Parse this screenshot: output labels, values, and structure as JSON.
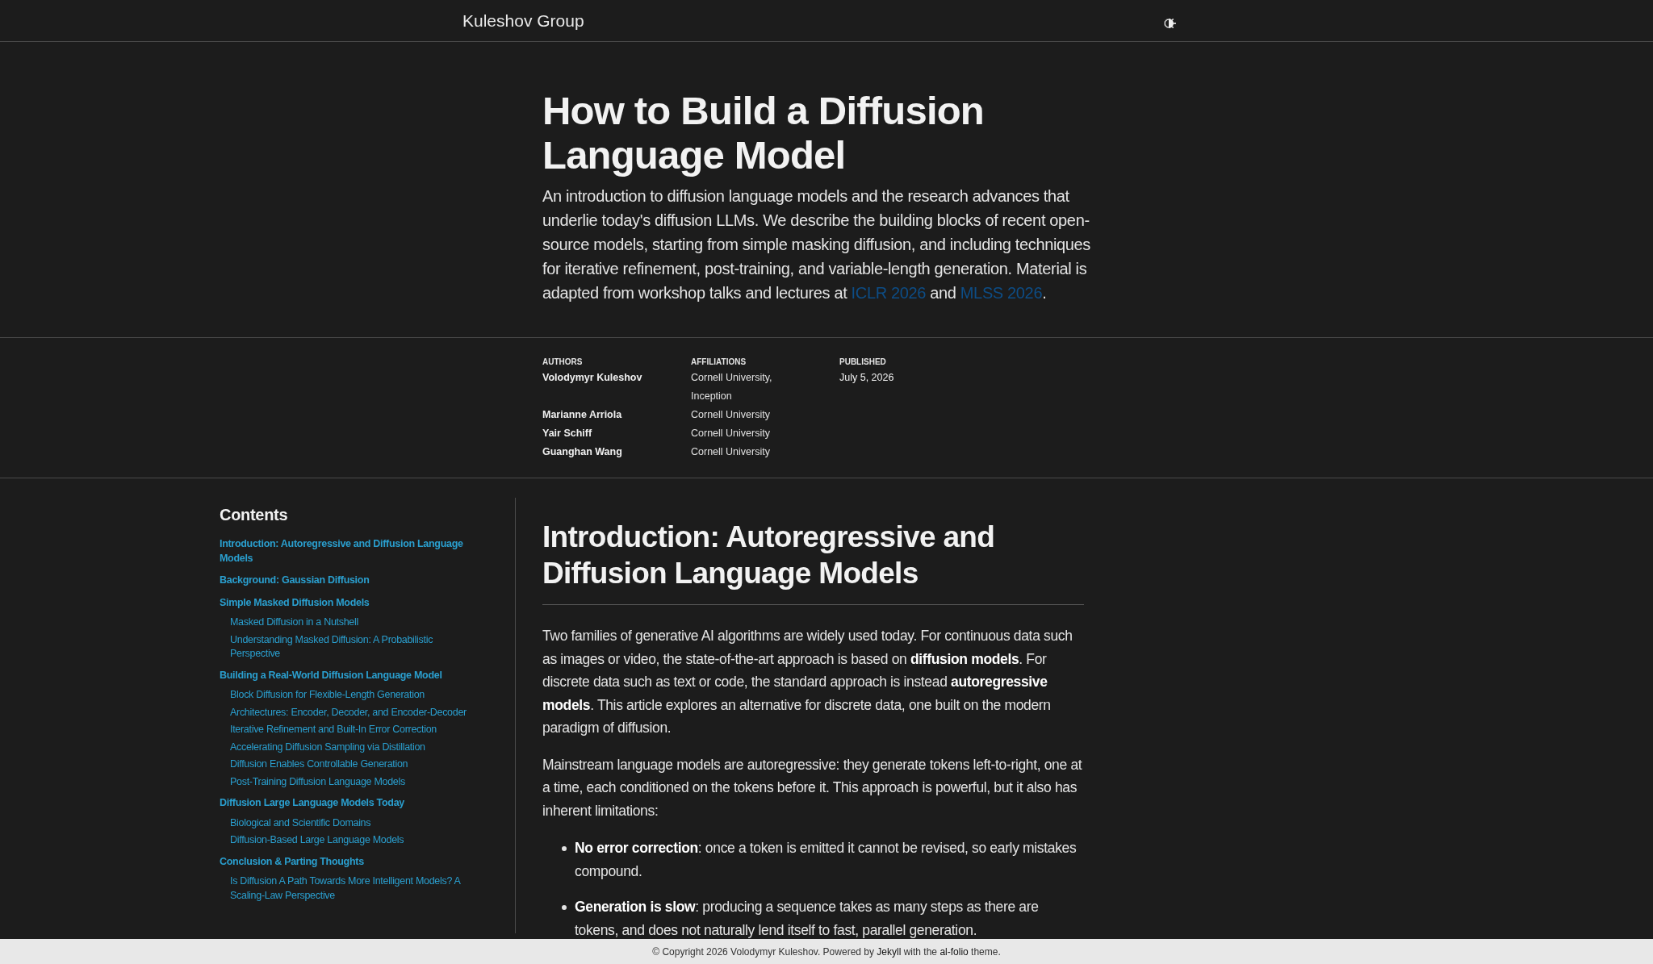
{
  "header": {
    "site_title": "Kuleshov Group"
  },
  "article": {
    "title": "How to Build a Diffusion Language Model",
    "description": [
      {
        "kind": "text",
        "text": "An introduction to diffusion language models and the research advances that underlie today's diffusion LLMs. We describe the building blocks of recent open-source models, starting from simple masking diffusion, and including techniques for iterative refinement, post-training, and variable-length generation. Material is adapted from workshop talks and lectures at "
      },
      {
        "kind": "link",
        "text": "ICLR 2026"
      },
      {
        "kind": "text",
        "text": " and "
      },
      {
        "kind": "link",
        "text": "MLSS 2026"
      },
      {
        "kind": "text",
        "text": "."
      }
    ]
  },
  "byline": {
    "authors_label": "AUTHORS",
    "affiliations_label": "AFFILIATIONS",
    "published_label": "PUBLISHED",
    "published": "July 5, 2026",
    "authors": [
      {
        "name": "Volodymyr Kuleshov",
        "affiliation": "Cornell University, Inception"
      },
      {
        "name": "Marianne Arriola",
        "affiliation": "Cornell University"
      },
      {
        "name": "Yair Schiff",
        "affiliation": "Cornell University"
      },
      {
        "name": "Guanghan Wang",
        "affiliation": "Cornell University"
      }
    ]
  },
  "contents": {
    "title": "Contents",
    "items": [
      {
        "label": "Introduction: Autoregressive and Diffusion Language Models"
      },
      {
        "label": "Background: Gaussian Diffusion"
      },
      {
        "label": "Simple Masked Diffusion Models",
        "children": [
          {
            "label": "Masked Diffusion in a Nutshell"
          },
          {
            "label": "Understanding Masked Diffusion: A Probabilistic Perspective"
          }
        ]
      },
      {
        "label": "Building a Real-World Diffusion Language Model",
        "children": [
          {
            "label": "Block Diffusion for Flexible-Length Generation"
          },
          {
            "label": "Architectures: Encoder, Decoder, and Encoder-Decoder"
          },
          {
            "label": "Iterative Refinement and Built-In Error Correction"
          },
          {
            "label": "Accelerating Diffusion Sampling via Distillation"
          },
          {
            "label": "Diffusion Enables Controllable Generation"
          },
          {
            "label": "Post-Training Diffusion Language Models"
          }
        ]
      },
      {
        "label": "Diffusion Large Language Models Today",
        "children": [
          {
            "label": "Biological and Scientific Domains"
          },
          {
            "label": "Diffusion-Based Large Language Models"
          }
        ]
      },
      {
        "label": "Conclusion & Parting Thoughts",
        "children": [
          {
            "label": "Is Diffusion A Path Towards More Intelligent Models? A Scaling-Law Perspective"
          }
        ]
      }
    ]
  },
  "section": {
    "heading": "Introduction: Autoregressive and Diffusion Language Models",
    "paragraphs": [
      "Two families of generative AI algorithms are widely used today. For continuous data such as images or video, the state-of-the-art approach is based on **diffusion models**. For discrete data such as text or code, the standard approach is instead **autoregressive models**. This article explores an alternative for discrete data, one built on the modern paradigm of diffusion.",
      "Mainstream language models are autoregressive: they generate tokens left-to-right, one at a time, each conditioned on the tokens before it. This approach is powerful, but it also has inherent limitations:"
    ],
    "bullets": [
      "**No error correction**: once a token is emitted it cannot be revised, so early mistakes compound.",
      "**Generation is slow**: producing a sequence takes as many steps as there are tokens, and does not naturally lend itself to fast, parallel generation."
    ]
  },
  "footer": {
    "parts": [
      {
        "kind": "text",
        "text": "© Copyright 2026 Volodymyr Kuleshov. Powered by "
      },
      {
        "kind": "link",
        "text": "Jekyll"
      },
      {
        "kind": "text",
        "text": " with the "
      },
      {
        "kind": "link",
        "text": "al-folio"
      },
      {
        "kind": "text",
        "text": " theme."
      }
    ]
  }
}
